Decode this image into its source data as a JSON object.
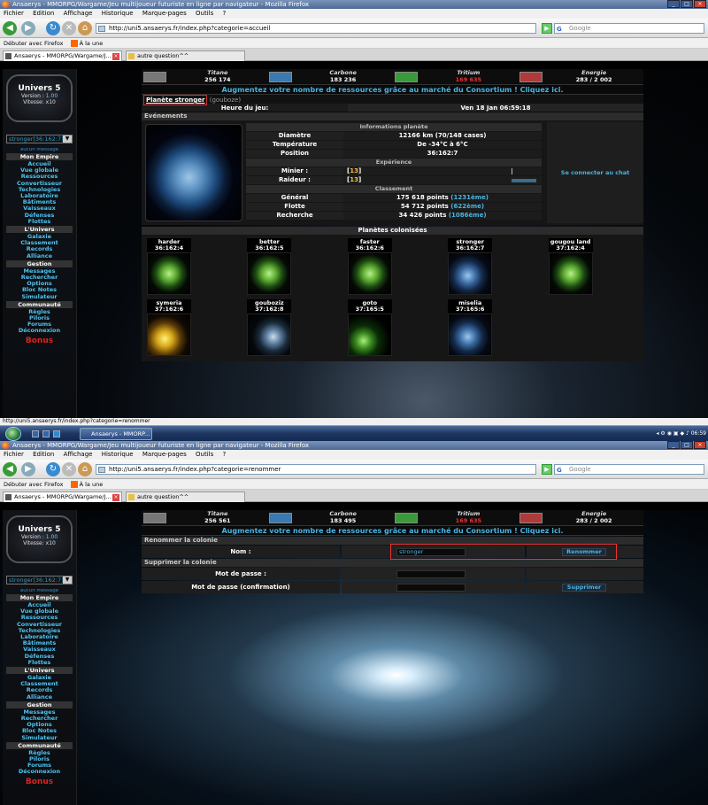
{
  "s1": {
    "window_title": "Ansaerys - MMORPG/Wargame/Jeu multijoueur futuriste en ligne par navigateur - Mozilla Firefox",
    "menu": [
      "Fichier",
      "Edition",
      "Affichage",
      "Historique",
      "Marque-pages",
      "Outils",
      "?"
    ],
    "url": "http://uni5.ansaerys.fr/index.php?categorie=accueil",
    "search_placeholder": "Google",
    "bookmarks": [
      "Débuter avec Firefox",
      "À la une"
    ],
    "tabs": [
      "Ansaerys - MMORPG/Wargame/J...",
      "autre question^^"
    ],
    "resources": [
      {
        "name": "Titane",
        "value": "256 174"
      },
      {
        "name": "Carbone",
        "value": "183 236"
      },
      {
        "name": "Tritium",
        "value": "169 635"
      },
      {
        "name": "Energie",
        "value": "283 / 2 002"
      }
    ],
    "banner": "Augmentez votre nombre de ressources grâce au marché du Consortium ! Cliquez ici.",
    "planet_link": "Planète stronger",
    "planet_owner": "(gouboze)",
    "game_time_label": "Heure du jeu:",
    "game_time_value": "Ven 18 Jan 06:59:18",
    "events_label": "Evénements",
    "info_header": "Informations planète",
    "info": [
      {
        "k": "Diamètre",
        "v": "12166 km (70/148 cases)"
      },
      {
        "k": "Température",
        "v": "De -34°C à 6°C"
      },
      {
        "k": "Position",
        "v": "36:162:7"
      }
    ],
    "xp_header": "Expérience",
    "xp": [
      {
        "k": "Minier :",
        "v": "13"
      },
      {
        "k": "Raideur :",
        "v": "13"
      }
    ],
    "rank_header": "Classement",
    "ranks": [
      {
        "k": "Général",
        "v": "175 618 points",
        "r": "(1231ème)"
      },
      {
        "k": "Flotte",
        "v": "54 712 points",
        "r": "(622ème)"
      },
      {
        "k": "Recherche",
        "v": "34 426 points",
        "r": "(1086ème)"
      }
    ],
    "chat": "Se connecter au chat",
    "colonies_header": "Planètes colonisées",
    "colonies": [
      {
        "name": "harder",
        "pos": "36:162:4"
      },
      {
        "name": "better",
        "pos": "36:162:5"
      },
      {
        "name": "faster",
        "pos": "36:162:6"
      },
      {
        "name": "stronger",
        "pos": "36:162:7"
      },
      {
        "name": "gougou land",
        "pos": "37:162:4"
      },
      {
        "name": "symeria",
        "pos": "37:162:6"
      },
      {
        "name": "gouboziz",
        "pos": "37:162:8"
      },
      {
        "name": "goto",
        "pos": "37:165:5"
      },
      {
        "name": "miselia",
        "pos": "37:165:6"
      }
    ],
    "status_url": "http://uni5.ansaerys.fr/index.php?categorie=renommer"
  },
  "sidebar": {
    "universe": "Univers 5",
    "version_label": "Version :",
    "version": "1.00",
    "speed": "Vitesse: x10",
    "planet_select": "stronger[36:162:7]",
    "messages": "aucun message",
    "sections": [
      {
        "title": "Mon Empire",
        "items": [
          "Accueil",
          "Vue globale",
          "Ressources",
          "Convertisseur",
          "Technologies",
          "Laboratoire",
          "Bâtiments",
          "Vaisseaux",
          "Défenses",
          "Flottes"
        ]
      },
      {
        "title": "L'Univers",
        "items": [
          "Galaxie",
          "Classement",
          "Records",
          "Alliance"
        ]
      },
      {
        "title": "Gestion",
        "items": [
          "Messages",
          "Rechercher",
          "Options",
          "Bloc Notes",
          "Simulateur"
        ]
      },
      {
        "title": "Communauté",
        "items": [
          "Règles",
          "Piloris",
          "Forums",
          "Déconnexion"
        ]
      }
    ],
    "bonus": "Bonus"
  },
  "taskbar": {
    "task": "Ansaerys - MMORP...",
    "clock": "06:59"
  },
  "s2": {
    "url": "http://uni5.ansaerys.fr/index.php?categorie=renommer",
    "resources": [
      {
        "name": "Titane",
        "value": "256 561"
      },
      {
        "name": "Carbone",
        "value": "183 495"
      },
      {
        "name": "Tritium",
        "value": "169 635"
      },
      {
        "name": "Energie",
        "value": "283 / 2 002"
      }
    ],
    "banner": "Augmentez votre nombre de ressources grâce au marché du Consortium ! Cliquez ici.",
    "rename_section": "Renommer la colonie",
    "name_label": "Nom :",
    "name_value": "stronger",
    "rename_button": "Renommer",
    "delete_section": "Supprimer la colonie",
    "password_label": "Mot de passe :",
    "password_confirm_label": "Mot de passe (confirmation)",
    "delete_button": "Supprimer"
  }
}
